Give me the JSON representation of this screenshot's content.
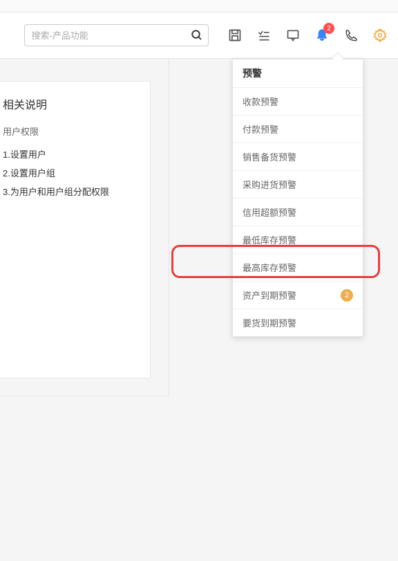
{
  "search": {
    "placeholder": "搜索-产品功能"
  },
  "toolbar": {
    "bell_badge": "2"
  },
  "left_panel": {
    "title": "相关说明",
    "subtitle": "用户权限",
    "items": [
      "1.设置用户",
      "2.设置用户组",
      "3.为用户和用户组分配权限"
    ]
  },
  "dropdown": {
    "header": "预警",
    "items": [
      {
        "label": "收款预警",
        "count": null
      },
      {
        "label": "付款预警",
        "count": null
      },
      {
        "label": "销售备货预警",
        "count": null
      },
      {
        "label": "采购进货预警",
        "count": null
      },
      {
        "label": "信用超额预警",
        "count": null
      },
      {
        "label": "最低库存预警",
        "count": null
      },
      {
        "label": "最高库存预警",
        "count": null
      },
      {
        "label": "资产到期预警",
        "count": "2"
      },
      {
        "label": "要货到期预警",
        "count": null
      }
    ]
  }
}
